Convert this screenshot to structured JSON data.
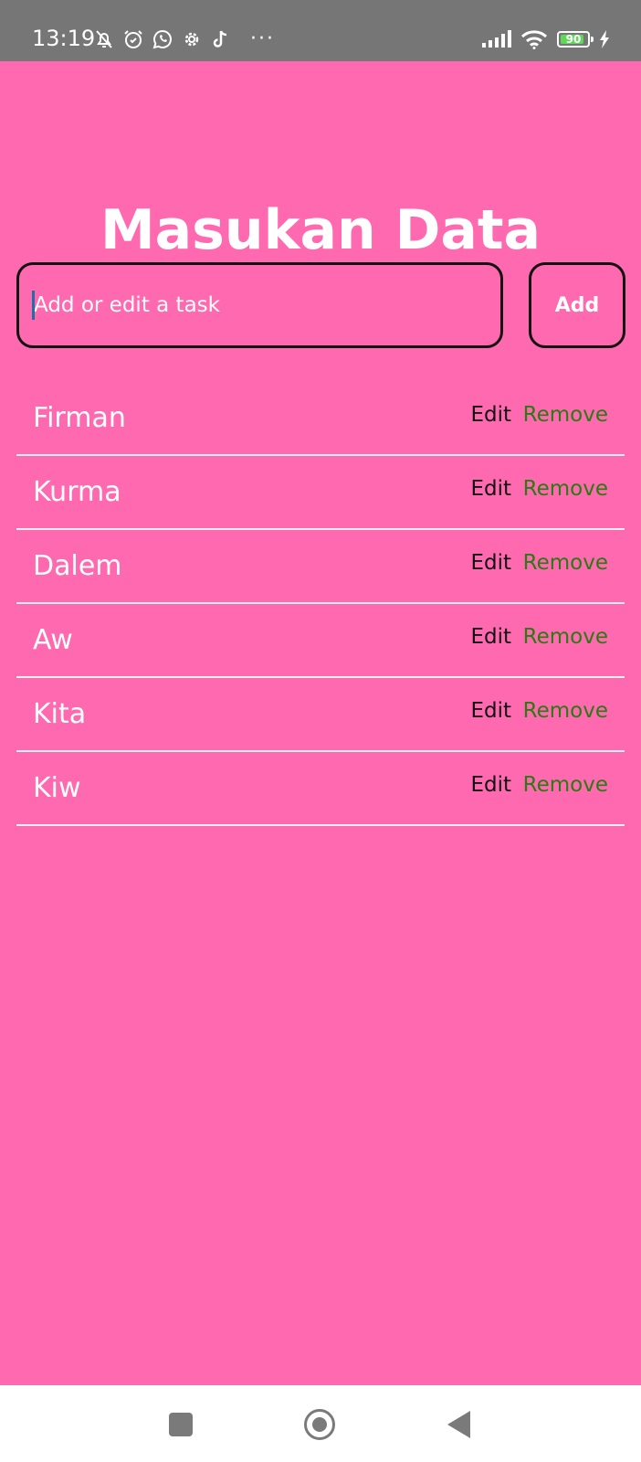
{
  "status_bar": {
    "time": "13:19",
    "icons_left": [
      "mute-bell-icon",
      "alarm-icon",
      "whatsapp-icon",
      "settings-gear-icon",
      "tiktok-icon"
    ],
    "more": "···",
    "icons_right": [
      "signal-icon",
      "wifi-icon",
      "battery-icon",
      "charging-icon"
    ],
    "battery_percent": "90",
    "battery_level": 0.9
  },
  "main": {
    "title": "Masukan Data",
    "input": {
      "placeholder": "Add or edit a task",
      "value": ""
    },
    "add_label": "Add"
  },
  "tasks": [
    {
      "name": "Firman",
      "edit": "Edit",
      "remove": "Remove"
    },
    {
      "name": "Kurma",
      "edit": "Edit",
      "remove": "Remove"
    },
    {
      "name": "Dalem",
      "edit": "Edit",
      "remove": "Remove"
    },
    {
      "name": "Aw",
      "edit": "Edit",
      "remove": "Remove"
    },
    {
      "name": "Kita",
      "edit": "Edit",
      "remove": "Remove"
    },
    {
      "name": "Kiw",
      "edit": "Edit",
      "remove": "Remove"
    }
  ],
  "nav_bar": {
    "buttons": [
      "recent-apps-icon",
      "home-icon",
      "back-icon"
    ]
  },
  "colors": {
    "background": "#ff69b0",
    "status_bar": "#767676",
    "remove": "#2a7a12",
    "edit": "#111111",
    "border": "#111111"
  }
}
